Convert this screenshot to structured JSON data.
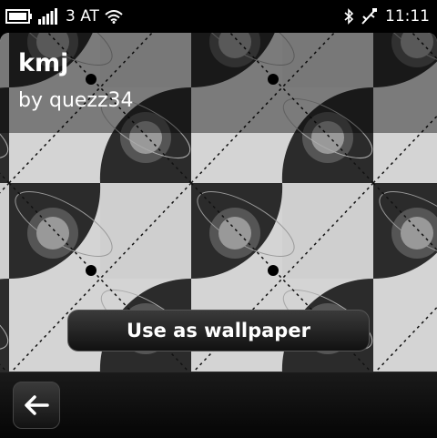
{
  "status_bar": {
    "carrier": "3 AT",
    "time": "11:11",
    "icons": [
      "battery-icon",
      "signal-strength-icon",
      "wifi-icon",
      "bluetooth-icon",
      "usb-icon"
    ]
  },
  "theme": {
    "name": "kmj",
    "author": "by quezz34"
  },
  "actions": {
    "use_wallpaper_label": "Use as wallpaper"
  },
  "toolbar": {
    "icons": [
      "back-arrow-icon"
    ]
  }
}
